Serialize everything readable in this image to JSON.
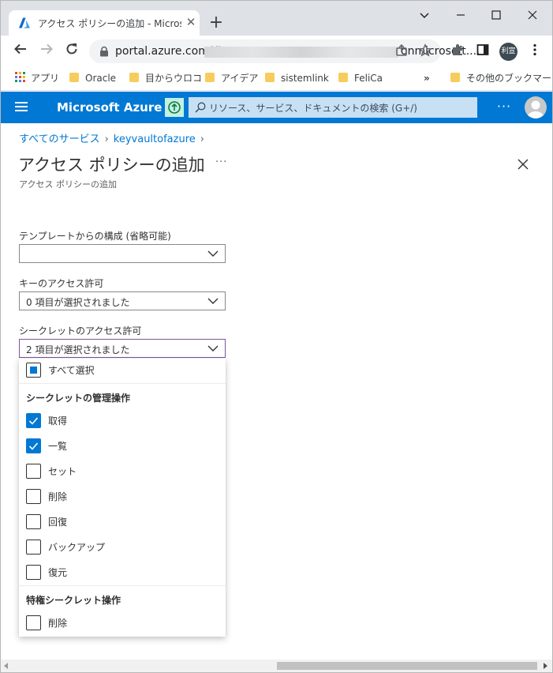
{
  "browser": {
    "tab_title": "アクセス ポリシーの追加 - Microsoft",
    "tab_close": "✕",
    "new_tab": "+",
    "url_prefix": "portal.azure.com/#",
    "url_suffix": "onmicrosoft....",
    "profile_chip": "利宣",
    "bookmarks": [
      "アプリ",
      "Oracle",
      "目からウロコ",
      "アイデア",
      "sistemlink",
      "FeliCa"
    ],
    "bookmarks_overflow": "»",
    "other_bookmarks": "その他のブックマーク"
  },
  "azure": {
    "brand": "Microsoft Azure",
    "search_placeholder": "リソース、サービス、ドキュメントの検索 (G+/)",
    "more": "···",
    "accent": "#0078d4"
  },
  "page": {
    "breadcrumb": [
      "すべてのサービス",
      "keyvaultofazure"
    ],
    "title": "アクセス ポリシーの追加",
    "title_more": "···",
    "subtitle": "アクセス ポリシーの追加"
  },
  "form": {
    "template_label": "テンプレートからの構成 (省略可能)",
    "template_value": "",
    "key_label": "キーのアクセス許可",
    "key_value": "0 項目が選択されました",
    "secret_label": "シークレットのアクセス許可",
    "secret_value": "2 項目が選択されました"
  },
  "secret_panel": {
    "select_all": "すべて選択",
    "select_all_state": "partial",
    "group1_title": "シークレットの管理操作",
    "group1_items": [
      {
        "label": "取得",
        "checked": true
      },
      {
        "label": "一覧",
        "checked": true
      },
      {
        "label": "セット",
        "checked": false
      },
      {
        "label": "削除",
        "checked": false
      },
      {
        "label": "回復",
        "checked": false
      },
      {
        "label": "バックアップ",
        "checked": false
      },
      {
        "label": "復元",
        "checked": false
      }
    ],
    "group2_title": "特権シークレット操作",
    "group2_items": [
      {
        "label": "削除",
        "checked": false
      }
    ]
  }
}
